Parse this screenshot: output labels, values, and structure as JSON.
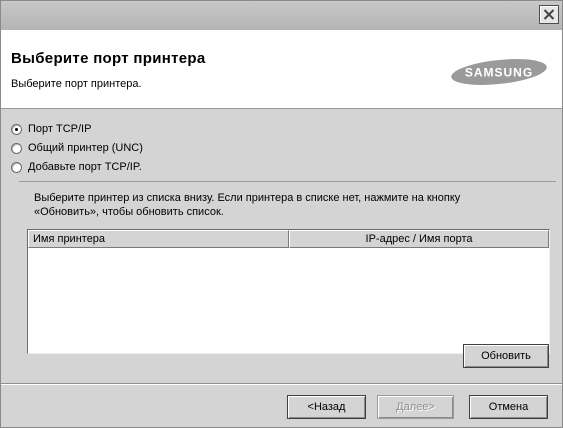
{
  "header": {
    "title": "Выберите порт принтера",
    "subtitle": "Выберите порт принтера.",
    "logo_text": "SAMSUNG"
  },
  "options": [
    {
      "label": "Порт TCP/IP",
      "checked": true
    },
    {
      "label": "Общий принтер (UNC)",
      "checked": false
    },
    {
      "label": "Добавьте порт TCP/IP.",
      "checked": false
    }
  ],
  "group": {
    "text_line1": "Выберите принтер из списка внизу. Если принтера в списке нет, нажмите на кнопку",
    "text_line2": "«Обновить», чтобы обновить список."
  },
  "list": {
    "columns": [
      "Имя принтера",
      "IP-адрес / Имя порта"
    ],
    "rows": []
  },
  "buttons": {
    "refresh": "Обновить",
    "back": "<Назад",
    "next": "Далее>",
    "cancel": "Отмена"
  },
  "colors": {
    "window_bg": "#d4d4d4",
    "header_bg": "#ffffff"
  }
}
